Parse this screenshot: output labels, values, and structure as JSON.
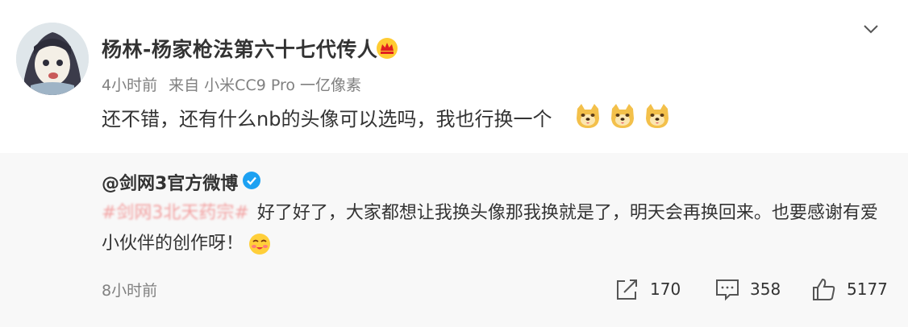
{
  "post": {
    "username": "杨林-杨家枪法第六十七代传人",
    "time": "4小时前",
    "source": "来自 小米CC9 Pro 一亿像素",
    "text": "还不错，还有什么nb的头像可以选吗，我也行换一个",
    "emojis": [
      "doge-icon",
      "doge-icon",
      "doge-icon"
    ]
  },
  "repost": {
    "username": "@剑网3官方微博",
    "topic": "#剑网3北天药宗#",
    "text": "好了好了，大家都想让我换头像那我换就是了，明天会再换回来。也要感谢有爱小伙伴的创作呀！",
    "time": "8小时前",
    "actions": {
      "repost_count": "170",
      "comment_count": "358",
      "like_count": "5177"
    }
  },
  "colors": {
    "text": "#333333",
    "muted": "#808080",
    "repost_bg": "#f8f8f8",
    "verified": "#1da1f2",
    "topic": "#f2a0a0"
  }
}
